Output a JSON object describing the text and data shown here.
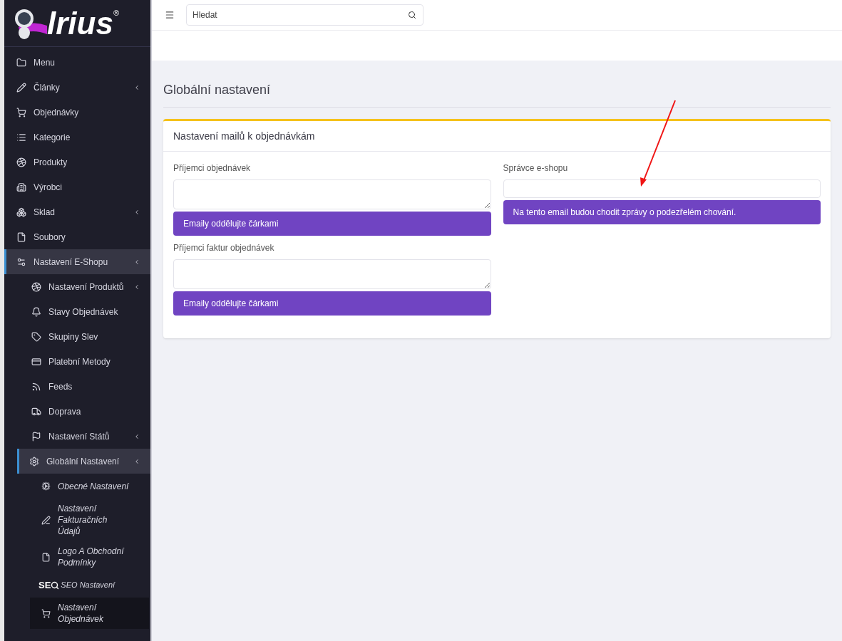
{
  "logo": {
    "text": "lrius",
    "mark": "®"
  },
  "sidebar": {
    "items": [
      {
        "label": "Menu",
        "has_submenu": false,
        "expanded": false,
        "selected": false
      },
      {
        "label": "Články",
        "has_submenu": true,
        "expanded": false,
        "selected": false
      },
      {
        "label": "Objednávky",
        "has_submenu": false,
        "expanded": false,
        "selected": false
      },
      {
        "label": "Kategorie",
        "has_submenu": false,
        "expanded": false,
        "selected": false
      },
      {
        "label": "Produkty",
        "has_submenu": false,
        "expanded": false,
        "selected": false
      },
      {
        "label": "Výrobci",
        "has_submenu": false,
        "expanded": false,
        "selected": false
      },
      {
        "label": "Sklad",
        "has_submenu": true,
        "expanded": false,
        "selected": false
      },
      {
        "label": "Soubory",
        "has_submenu": false,
        "expanded": false,
        "selected": false
      },
      {
        "label": "Nastavení E-Shopu",
        "has_submenu": true,
        "expanded": true,
        "selected": false,
        "children": [
          {
            "label": "Nastavení Produktů",
            "has_submenu": true,
            "expanded": false,
            "selected": false
          },
          {
            "label": "Stavy Objednávek",
            "has_submenu": false,
            "expanded": false,
            "selected": false
          },
          {
            "label": "Skupiny Slev",
            "has_submenu": false,
            "expanded": false,
            "selected": false
          },
          {
            "label": "Platební Metody",
            "has_submenu": false,
            "expanded": false,
            "selected": false
          },
          {
            "label": "Feeds",
            "has_submenu": false,
            "expanded": false,
            "selected": false
          },
          {
            "label": "Doprava",
            "has_submenu": false,
            "expanded": false,
            "selected": false
          },
          {
            "label": "Nastavení Států",
            "has_submenu": true,
            "expanded": false,
            "selected": false
          },
          {
            "label": "Globální Nastavení",
            "has_submenu": true,
            "expanded": true,
            "selected": false,
            "children": [
              {
                "label": "Obecné Nastavení",
                "selected": false
              },
              {
                "label": "Nastavení Fakturačních Údajů",
                "selected": false
              },
              {
                "label": "Logo A Obchodní Podmínky",
                "selected": false
              },
              {
                "label": "SEO Nastavení",
                "icon_text": "SE",
                "selected": false
              },
              {
                "label": "Nastavení Objednávek",
                "selected": true
              }
            ]
          }
        ]
      }
    ]
  },
  "search": {
    "placeholder": "Hledat"
  },
  "page_title": "Globální nastavení",
  "card": {
    "title": "Nastavení mailů k objednávkám",
    "columns": [
      [
        {
          "label": "Příjemci objednávek",
          "kind": "textarea",
          "hint": "Emaily oddělujte čárkami"
        },
        {
          "label": "Příjemci faktur objednávek",
          "kind": "textarea",
          "hint": "Emaily oddělujte čárkami"
        }
      ],
      [
        {
          "label": "Správce e-shopu",
          "kind": "input",
          "hint": "Na tento email budou chodit zprávy o podezřelém chování."
        }
      ]
    ]
  }
}
